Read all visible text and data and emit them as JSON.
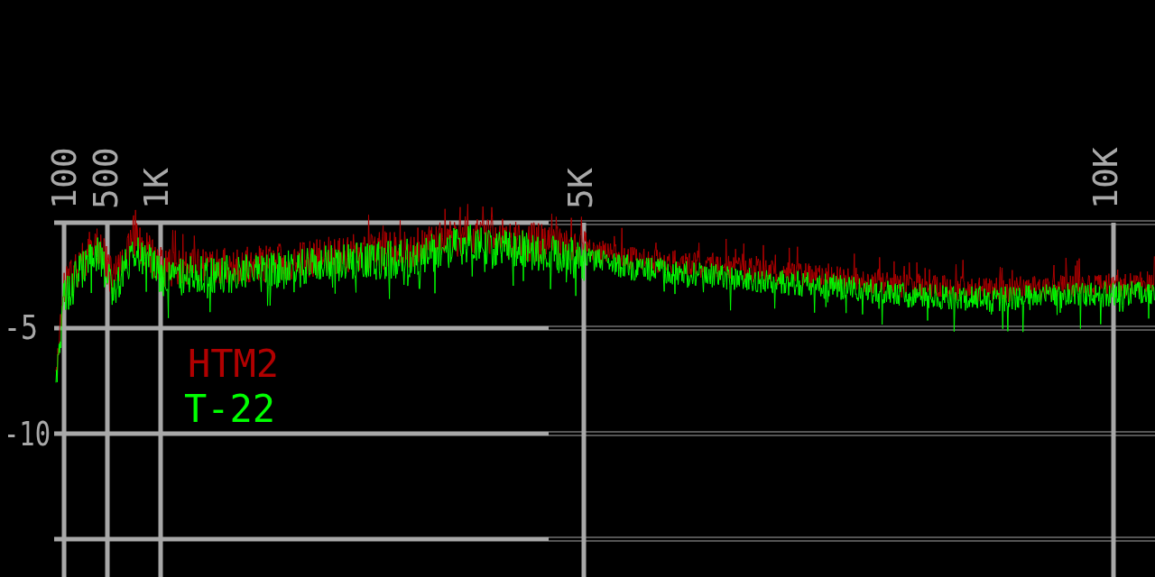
{
  "x_ticks": [
    {
      "label": "100"
    },
    {
      "label": "500"
    },
    {
      "label": "1K"
    },
    {
      "label": "5K"
    },
    {
      "label": "10K"
    }
  ],
  "y_ticks": [
    {
      "label": "-5"
    },
    {
      "label": "-10"
    }
  ],
  "legend": [
    {
      "name": "HTM2",
      "color": "#b00000"
    },
    {
      "name": "T-22",
      "color": "#00ff00"
    }
  ]
}
